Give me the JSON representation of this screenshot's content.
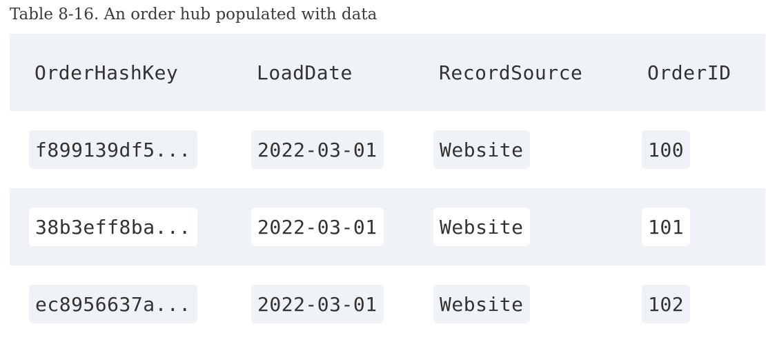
{
  "caption": "Table 8-16. An order hub populated with data",
  "table": {
    "headers": [
      "OrderHashKey",
      "LoadDate",
      "RecordSource",
      "OrderID"
    ],
    "rows": [
      [
        "f899139df5...",
        "2022-03-01",
        "Website",
        "100"
      ],
      [
        "38b3eff8ba...",
        "2022-03-01",
        "Website",
        "101"
      ],
      [
        "ec8956637a...",
        "2022-03-01",
        "Website",
        "102"
      ]
    ]
  },
  "colors": {
    "stripe": "#eff2f6",
    "text": "#333333"
  }
}
